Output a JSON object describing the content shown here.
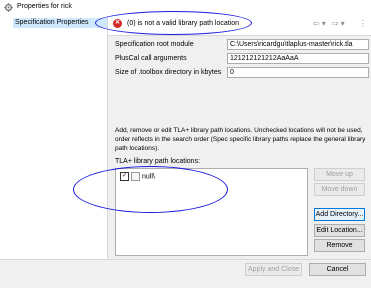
{
  "window": {
    "title": "Properties for rick",
    "app_icon": "gear-icon"
  },
  "sidebar": {
    "items": [
      {
        "label": "Specification Properties",
        "selected": true
      }
    ]
  },
  "header": {
    "error_icon": "error-icon",
    "error_icon_glyph": "✕",
    "error_message": "(0) is not a valid library path location",
    "nav": {
      "back_glyph": "⇦",
      "forward_glyph": "⇨",
      "dropdown_glyph": "▾",
      "menu_glyph": "⋮"
    }
  },
  "form": {
    "root_module_label": "Specification root module",
    "root_module_value": "C:\\Users\\ricardgu\\tlaplus-master\\rick.tla",
    "pluscal_label": "PlusCal call arguments",
    "pluscal_value": "121212121212AaAaA",
    "toolbox_size_label": "Size of .toolbox directory in kbytes",
    "toolbox_size_value": "0"
  },
  "library": {
    "description": "Add, remove or edit TLA+ library path locations. Unchecked locations will not be used, order reflects in the search order (Spec specific library paths replace the general library path locations).",
    "list_label": "TLA+ library path locations:",
    "items": [
      {
        "checked": true,
        "check_glyph": "✓",
        "label": "null\\"
      }
    ],
    "buttons": {
      "move_up": "Move up",
      "move_down": "Move down",
      "add_directory": "Add Directory...",
      "edit_location": "Edit Location...",
      "remove": "Remove"
    }
  },
  "footer": {
    "apply_close": "Apply and Close",
    "cancel": "Cancel"
  },
  "colors": {
    "annotation": "#1b1be0",
    "error": "#d42a2a",
    "selection": "#cde8ff",
    "focus": "#0078d7"
  }
}
